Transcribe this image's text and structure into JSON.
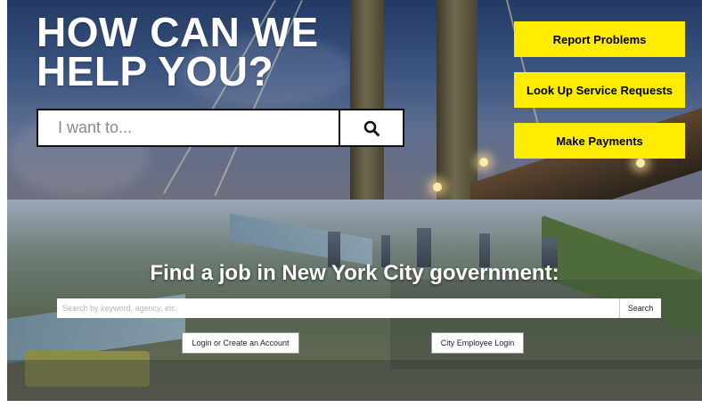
{
  "hero": {
    "title_line1": "HOW CAN WE",
    "title_line2": "HELP YOU?",
    "search_placeholder": "I want to...",
    "search_icon": "search-icon",
    "actions": [
      {
        "label": "Report Problems"
      },
      {
        "label": "Look Up Service Requests"
      },
      {
        "label": "Make Payments"
      }
    ],
    "accent_color": "#ffec00"
  },
  "jobs": {
    "title": "Find a job in New York City government:",
    "search_placeholder": "Search by keyword, agency, etc.",
    "search_button": "Search",
    "login_button": "Login or Create an Account",
    "employee_login_button": "City Employee Login"
  }
}
